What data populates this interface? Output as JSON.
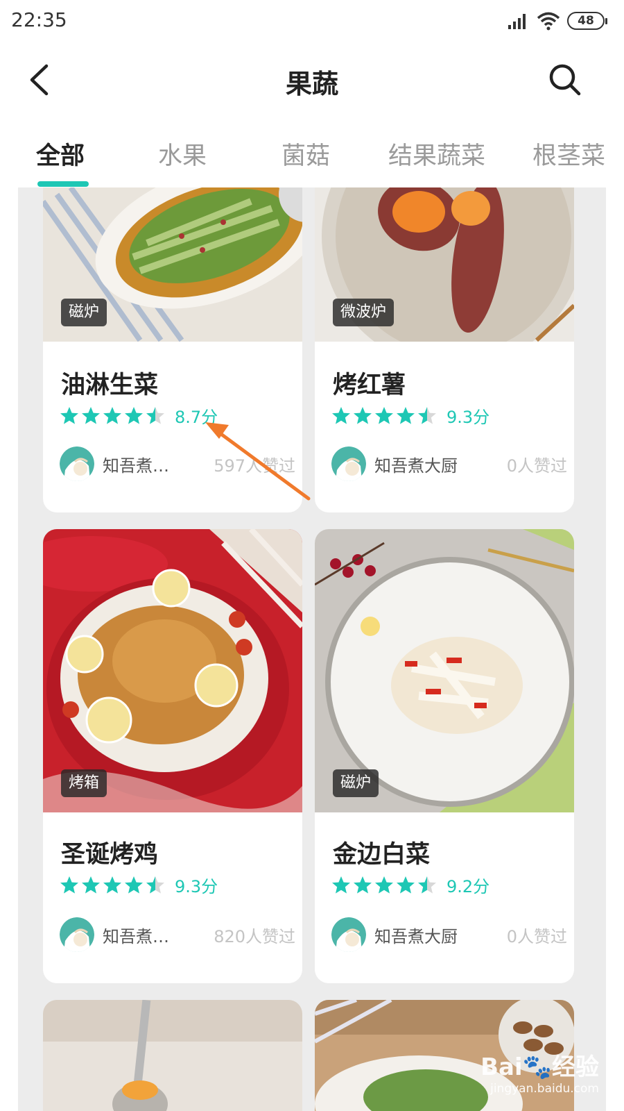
{
  "status_bar": {
    "time": "22:35",
    "battery": "48"
  },
  "header": {
    "title": "果蔬"
  },
  "tabs": [
    {
      "label": "全部",
      "active": true
    },
    {
      "label": "水果",
      "active": false
    },
    {
      "label": "菌菇",
      "active": false
    },
    {
      "label": "结果蔬菜",
      "active": false
    },
    {
      "label": "根茎菜",
      "active": false
    }
  ],
  "recipes": [
    {
      "title": "油淋生菜",
      "tag": "磁炉",
      "rating": 4.5,
      "score": "8.7分",
      "author": "知吾煮…",
      "likes": "597人赞过"
    },
    {
      "title": "烤红薯",
      "tag": "微波炉",
      "rating": 4.5,
      "score": "9.3分",
      "author": "知吾煮大厨",
      "likes": "0人赞过"
    },
    {
      "title": "圣诞烤鸡",
      "tag": "烤箱",
      "rating": 4.5,
      "score": "9.3分",
      "author": "知吾煮…",
      "likes": "820人赞过"
    },
    {
      "title": "金边白菜",
      "tag": "磁炉",
      "rating": 4.5,
      "score": "9.2分",
      "author": "知吾煮大厨",
      "likes": "0人赞过"
    }
  ],
  "colors": {
    "accent": "#1ec7b4",
    "annotation_arrow": "#f07a2c"
  },
  "watermark": {
    "logo": "Bai🐾经验",
    "url": "jingyan.baidu.com"
  }
}
